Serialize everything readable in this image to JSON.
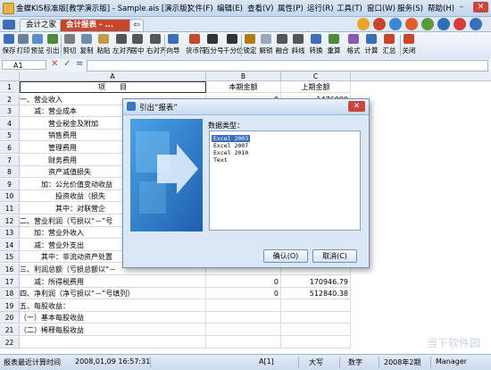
{
  "window": {
    "title": "金蝶KIS标准版[教学演示版] - Sample.ais [演示版]",
    "menus": [
      "文件(F)",
      "编辑(E)",
      "查看(V)",
      "属性(P)",
      "运行(R)",
      "工具(T)",
      "窗口(W)",
      "服务(S)",
      "帮助(H)"
    ],
    "controls": {
      "minimize": "–",
      "maximize": "□",
      "close": "✕"
    }
  },
  "tabs": [
    {
      "label": "会计之家"
    },
    {
      "label": "会计报表 - ..."
    },
    {
      "label": "⇦"
    }
  ],
  "toolbar": {
    "items": [
      {
        "label": "保存",
        "icon": "save-icon",
        "color": "#3c6fb6"
      },
      {
        "label": "打印",
        "icon": "print-icon",
        "color": "#6b7f98"
      },
      {
        "label": "预览",
        "icon": "preview-icon",
        "color": "#5b8fc9"
      },
      {
        "label": "引出",
        "icon": "export-icon",
        "color": "#4d8a3c"
      },
      {
        "label": "剪切",
        "icon": "cut-icon",
        "color": "#7d7d7d"
      },
      {
        "label": "复制",
        "icon": "copy-icon",
        "color": "#6f8db3"
      },
      {
        "label": "粘贴",
        "icon": "paste-icon",
        "color": "#c39a4a"
      },
      {
        "label": "左对齐",
        "icon": "align-left-icon",
        "color": "#555"
      },
      {
        "label": "居中",
        "icon": "align-center-icon",
        "color": "#555"
      },
      {
        "label": "右对齐",
        "icon": "align-right-icon",
        "color": "#555"
      },
      {
        "label": "向导",
        "icon": "wizard-icon",
        "color": "#3c6fb6"
      },
      {
        "label": "货币符",
        "icon": "currency-icon",
        "color": "#c8462a"
      },
      {
        "label": "百分号",
        "icon": "percent-icon",
        "color": "#333"
      },
      {
        "label": "千分位",
        "icon": "thousands-icon",
        "color": "#333"
      },
      {
        "label": "锁定",
        "icon": "lock-icon",
        "color": "#b07c14"
      },
      {
        "label": "解锁",
        "icon": "unlock-icon",
        "color": "#9aa7b8"
      },
      {
        "label": "融合",
        "icon": "merge-icon",
        "color": "#555"
      },
      {
        "label": "斜线",
        "icon": "diagonal-icon",
        "color": "#555"
      },
      {
        "label": "转换",
        "icon": "convert-icon",
        "color": "#3c6fb6"
      },
      {
        "label": "重算",
        "icon": "recalc-icon",
        "color": "#4d8a3c"
      },
      {
        "label": "格式",
        "icon": "format-icon",
        "color": "#8a5ab0"
      },
      {
        "label": "计算",
        "icon": "calculate-icon",
        "color": "#3c6fb6"
      },
      {
        "label": "汇总",
        "icon": "summary-icon",
        "color": "#c8462a"
      },
      {
        "label": "关闭",
        "icon": "close-icon",
        "color": "#c8462a"
      }
    ]
  },
  "formula_bar": {
    "cell_ref": "A1",
    "cancel": "✕",
    "confirm": "✓",
    "equals": "="
  },
  "grid": {
    "columns": [
      "A",
      "B",
      "C"
    ],
    "rows": [
      {
        "n": "1",
        "a": "项　　目",
        "b": "本期金额",
        "c": "上期金额"
      },
      {
        "n": "2",
        "a": "一、营业收入",
        "b": "0",
        "c": "1476000"
      },
      {
        "n": "3",
        "a": "　　减：营业成本",
        "b": "",
        "c": ""
      },
      {
        "n": "4",
        "a": "　　　　营业税金及附加",
        "b": "",
        "c": ""
      },
      {
        "n": "5",
        "a": "　　　　销售费用",
        "b": "",
        "c": ""
      },
      {
        "n": "6",
        "a": "　　　　管理费用",
        "b": "",
        "c": ""
      },
      {
        "n": "7",
        "a": "　　　　财务费用",
        "b": "",
        "c": ""
      },
      {
        "n": "8",
        "a": "　　　　资产减值损失",
        "b": "",
        "c": ""
      },
      {
        "n": "9",
        "a": "　　　加：公允价值变动收益",
        "b": "",
        "c": ""
      },
      {
        "n": "10",
        "a": "　　　　　投资收益（损失",
        "b": "",
        "c": ""
      },
      {
        "n": "11",
        "a": "　　　　　其中：对联营企",
        "b": "",
        "c": ""
      },
      {
        "n": "12",
        "a": "二、营业利润（亏损以“－”号",
        "b": "",
        "c": ""
      },
      {
        "n": "13",
        "a": "　　加：营业外收入",
        "b": "",
        "c": ""
      },
      {
        "n": "14",
        "a": "　　减：营业外支出",
        "b": "",
        "c": ""
      },
      {
        "n": "15",
        "a": "　　　其中：非流动资产处置",
        "b": "",
        "c": ""
      },
      {
        "n": "16",
        "a": "三、利润总额（亏损总额以“－",
        "b": "",
        "c": ""
      },
      {
        "n": "17",
        "a": "　　减：所得税费用",
        "b": "0",
        "c": "170946.79"
      },
      {
        "n": "18",
        "a": "四、净利润（净亏损以“－”号填列）",
        "b": "0",
        "c": "512840.38"
      },
      {
        "n": "19",
        "a": "五、每股收益：",
        "b": "",
        "c": ""
      },
      {
        "n": "20",
        "a": "（一）基本每股收益",
        "b": "",
        "c": ""
      },
      {
        "n": "21",
        "a": "（二）稀释每股收益",
        "b": "",
        "c": ""
      },
      {
        "n": "22",
        "a": "",
        "b": "",
        "c": ""
      }
    ]
  },
  "dialog": {
    "title": "引出“报表”",
    "label": "数据类型：",
    "options": [
      "Excel 2003",
      "Excel 2007",
      "Excel 2010",
      "Text"
    ],
    "selected": "Excel 2003",
    "ok": "确认(O)",
    "cancel": "取消(C)",
    "close": "✕"
  },
  "status": {
    "last_calc": "报表最近计算时间",
    "timestamp": "2008,01,09 16:57:31",
    "cell": "A[1]",
    "case": "大写",
    "numlock": "数字",
    "period": "2008年2期",
    "user": "Manager"
  },
  "watermark": "当下软件园"
}
